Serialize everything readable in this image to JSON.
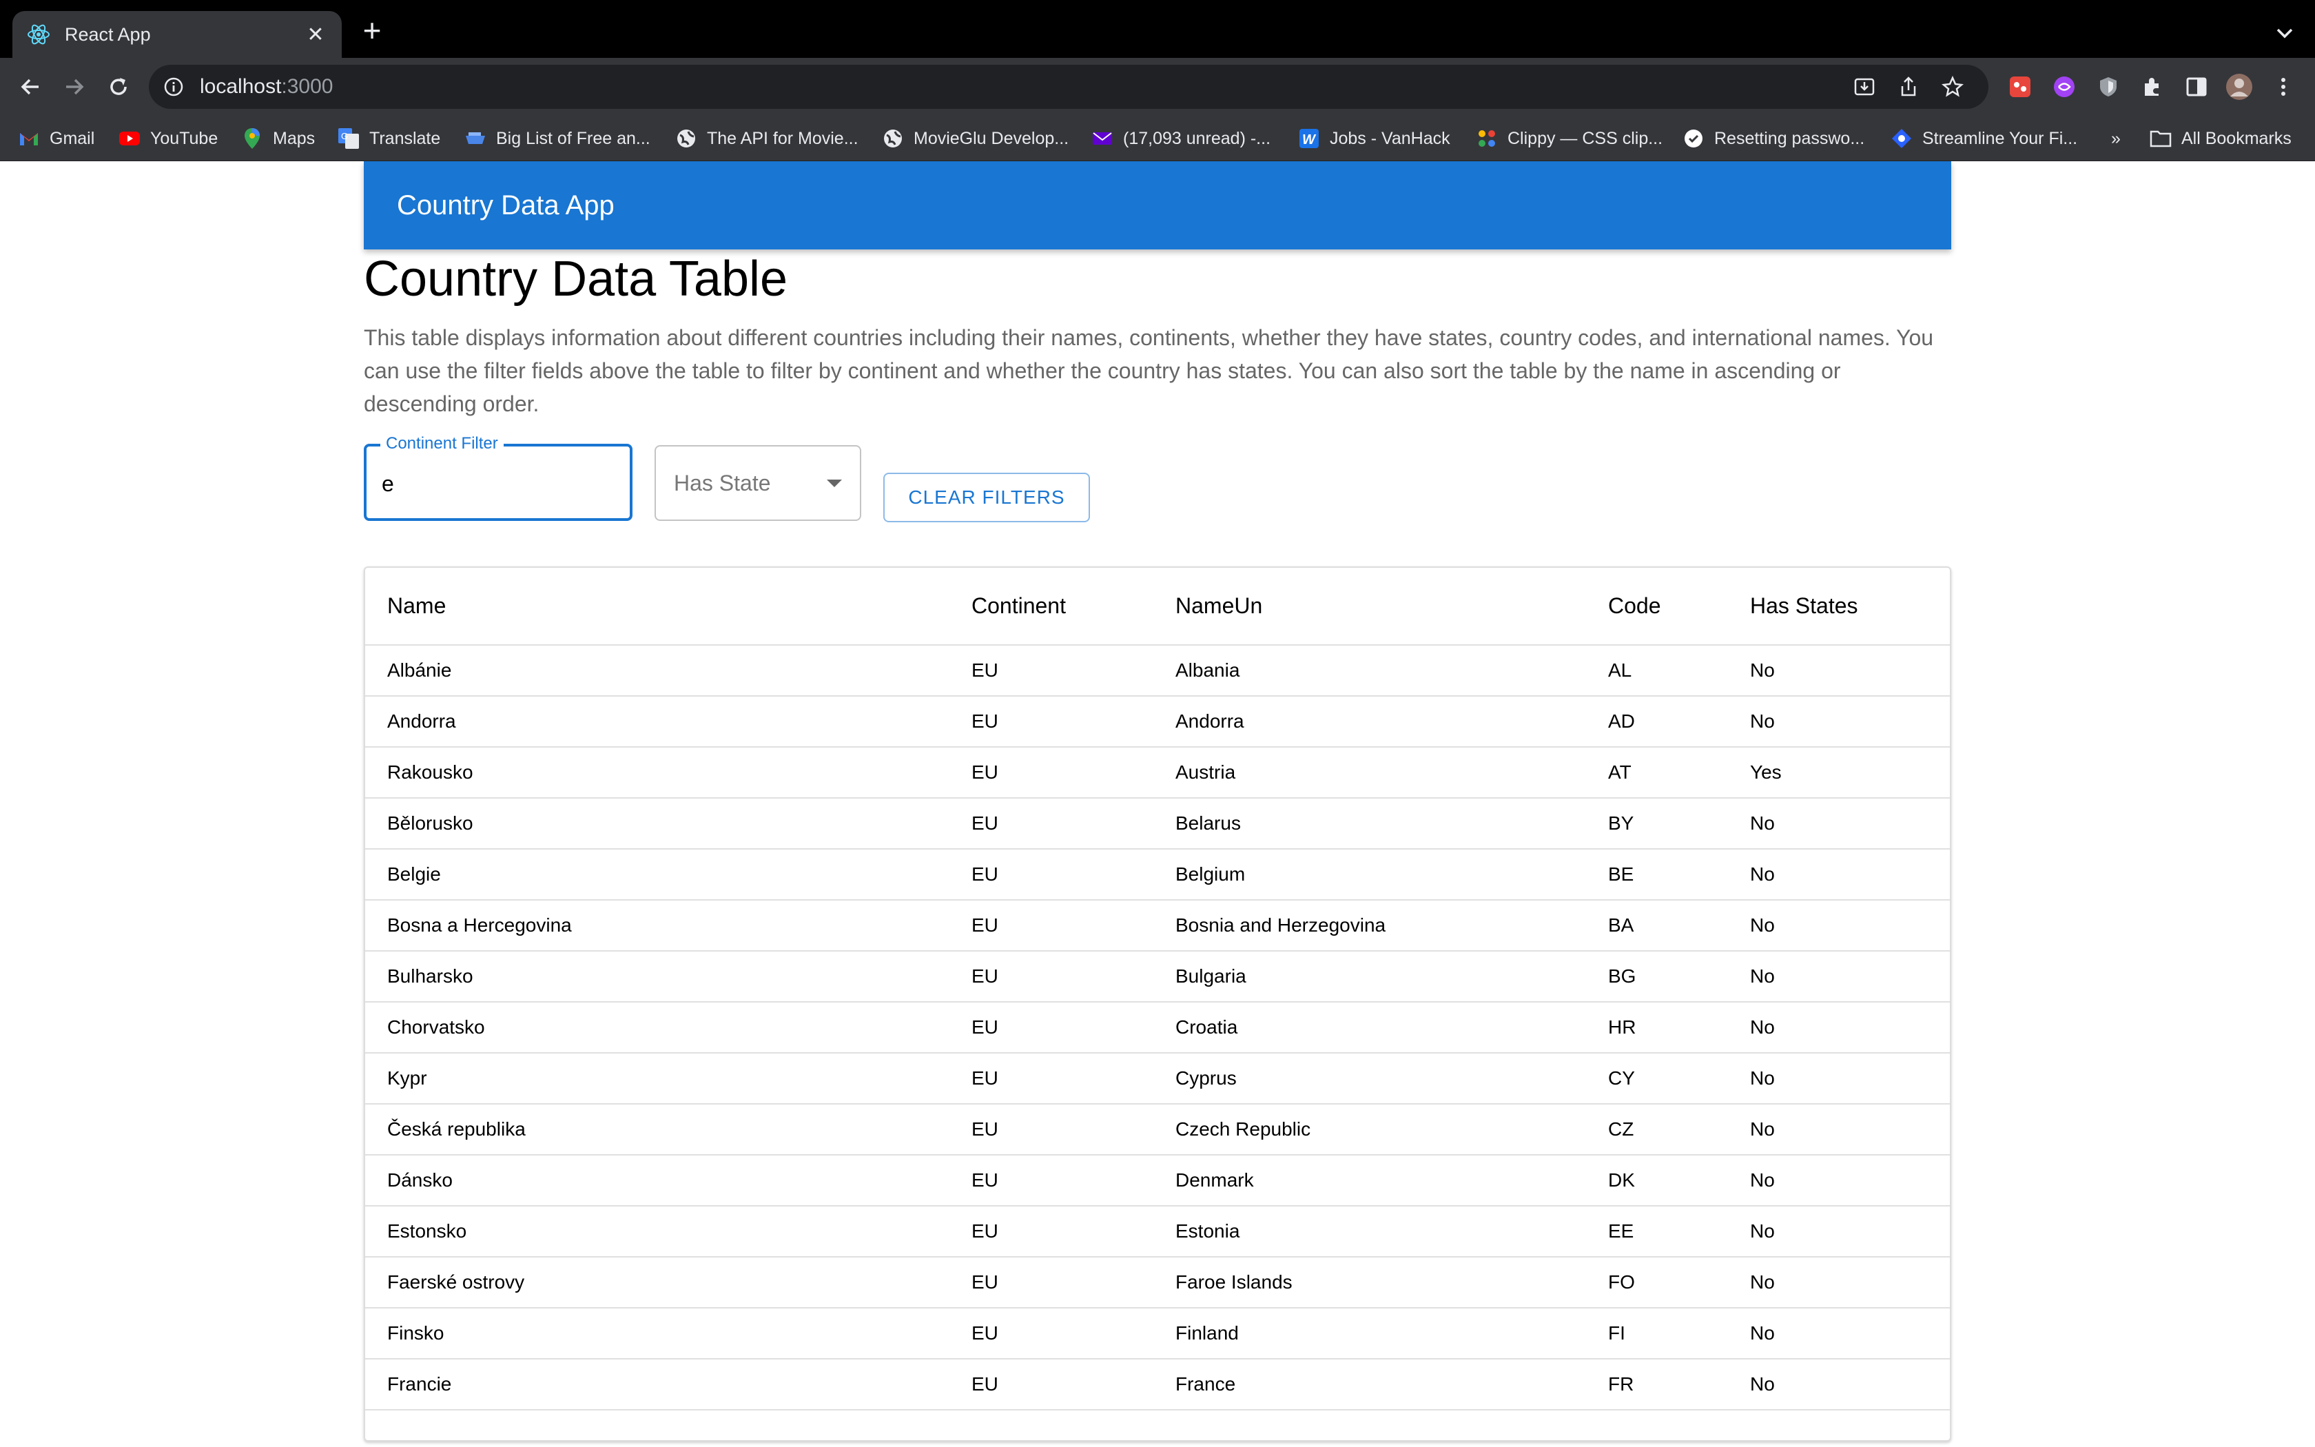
{
  "browser": {
    "tab_title": "React App",
    "url_host": "localhost",
    "url_port": ":3000",
    "bookmarks": [
      {
        "label": "Gmail",
        "icon": "gmail-icon"
      },
      {
        "label": "YouTube",
        "icon": "youtube-icon"
      },
      {
        "label": "Maps",
        "icon": "maps-icon"
      },
      {
        "label": "Translate",
        "icon": "translate-icon"
      },
      {
        "label": "Big List of Free an...",
        "icon": "bookmark-icon"
      },
      {
        "label": "The API for Movie...",
        "icon": "globe-icon"
      },
      {
        "label": "MovieGlu Develop...",
        "icon": "globe-icon"
      },
      {
        "label": "(17,093 unread) -...",
        "icon": "mail-icon"
      },
      {
        "label": "Jobs - VanHack",
        "icon": "vanhack-icon"
      },
      {
        "label": "Clippy — CSS clip...",
        "icon": "clippy-icon"
      },
      {
        "label": "Resetting passwo...",
        "icon": "check-icon"
      },
      {
        "label": "Streamline Your Fi...",
        "icon": "streamline-icon"
      }
    ],
    "more_bookmarks": "»",
    "all_bookmarks": "All Bookmarks"
  },
  "app": {
    "appbar_title": "Country Data App",
    "page_title": "Country Data Table",
    "description": "This table displays information about different countries including their names, continents, whether they have states, country codes, and international names. You can use the filter fields above the table to filter by continent and whether the country has states. You can also sort the table by the name in ascending or descending order.",
    "continent_filter": {
      "label": "Continent Filter",
      "value": "e"
    },
    "has_state_select": {
      "label": "Has State"
    },
    "clear_button": "CLEAR FILTERS"
  },
  "table": {
    "headers": {
      "name": "Name",
      "continent": "Continent",
      "nameun": "NameUn",
      "code": "Code",
      "has_states": "Has States"
    },
    "rows": [
      {
        "name": "Albánie",
        "continent": "EU",
        "nameun": "Albania",
        "code": "AL",
        "has_states": "No"
      },
      {
        "name": "Andorra",
        "continent": "EU",
        "nameun": "Andorra",
        "code": "AD",
        "has_states": "No"
      },
      {
        "name": "Rakousko",
        "continent": "EU",
        "nameun": "Austria",
        "code": "AT",
        "has_states": "Yes"
      },
      {
        "name": "Bělorusko",
        "continent": "EU",
        "nameun": "Belarus",
        "code": "BY",
        "has_states": "No"
      },
      {
        "name": "Belgie",
        "continent": "EU",
        "nameun": "Belgium",
        "code": "BE",
        "has_states": "No"
      },
      {
        "name": "Bosna a Hercegovina",
        "continent": "EU",
        "nameun": "Bosnia and Herzegovina",
        "code": "BA",
        "has_states": "No"
      },
      {
        "name": "Bulharsko",
        "continent": "EU",
        "nameun": "Bulgaria",
        "code": "BG",
        "has_states": "No"
      },
      {
        "name": "Chorvatsko",
        "continent": "EU",
        "nameun": "Croatia",
        "code": "HR",
        "has_states": "No"
      },
      {
        "name": "Kypr",
        "continent": "EU",
        "nameun": "Cyprus",
        "code": "CY",
        "has_states": "No"
      },
      {
        "name": "Česká republika",
        "continent": "EU",
        "nameun": "Czech Republic",
        "code": "CZ",
        "has_states": "No"
      },
      {
        "name": "Dánsko",
        "continent": "EU",
        "nameun": "Denmark",
        "code": "DK",
        "has_states": "No"
      },
      {
        "name": "Estonsko",
        "continent": "EU",
        "nameun": "Estonia",
        "code": "EE",
        "has_states": "No"
      },
      {
        "name": "Faerské ostrovy",
        "continent": "EU",
        "nameun": "Faroe Islands",
        "code": "FO",
        "has_states": "No"
      },
      {
        "name": "Finsko",
        "continent": "EU",
        "nameun": "Finland",
        "code": "FI",
        "has_states": "No"
      },
      {
        "name": "Francie",
        "continent": "EU",
        "nameun": "France",
        "code": "FR",
        "has_states": "No"
      }
    ]
  }
}
